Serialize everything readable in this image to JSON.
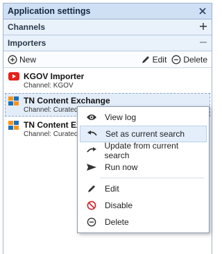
{
  "window": {
    "title": "Application settings"
  },
  "sections": {
    "channels": "Channels",
    "importers": "Importers"
  },
  "toolbar": {
    "new_label": "New",
    "edit_label": "Edit",
    "delete_label": "Delete"
  },
  "importers": [
    {
      "name": "KGOV Importer",
      "channel": "Channel: KGOV",
      "icon": "youtube-icon"
    },
    {
      "name": "TN Content Exchange",
      "channel": "Channel: Curated -",
      "icon": "windows-tile-icon"
    },
    {
      "name": "TN Content Ex",
      "channel": "Channel: Curated -",
      "icon": "windows-tile-icon"
    }
  ],
  "context_menu": {
    "view_log": "View log",
    "set_current": "Set as current search",
    "update_current": "Update from current search",
    "run_now": "Run now",
    "edit": "Edit",
    "disable": "Disable",
    "delete": "Delete"
  },
  "colors": {
    "accent": "#cfe0f5",
    "selection": "#e3edf9",
    "youtube": "#e62117",
    "tile_orange": "#f7941d",
    "tile_blue": "#1c6fb5"
  }
}
